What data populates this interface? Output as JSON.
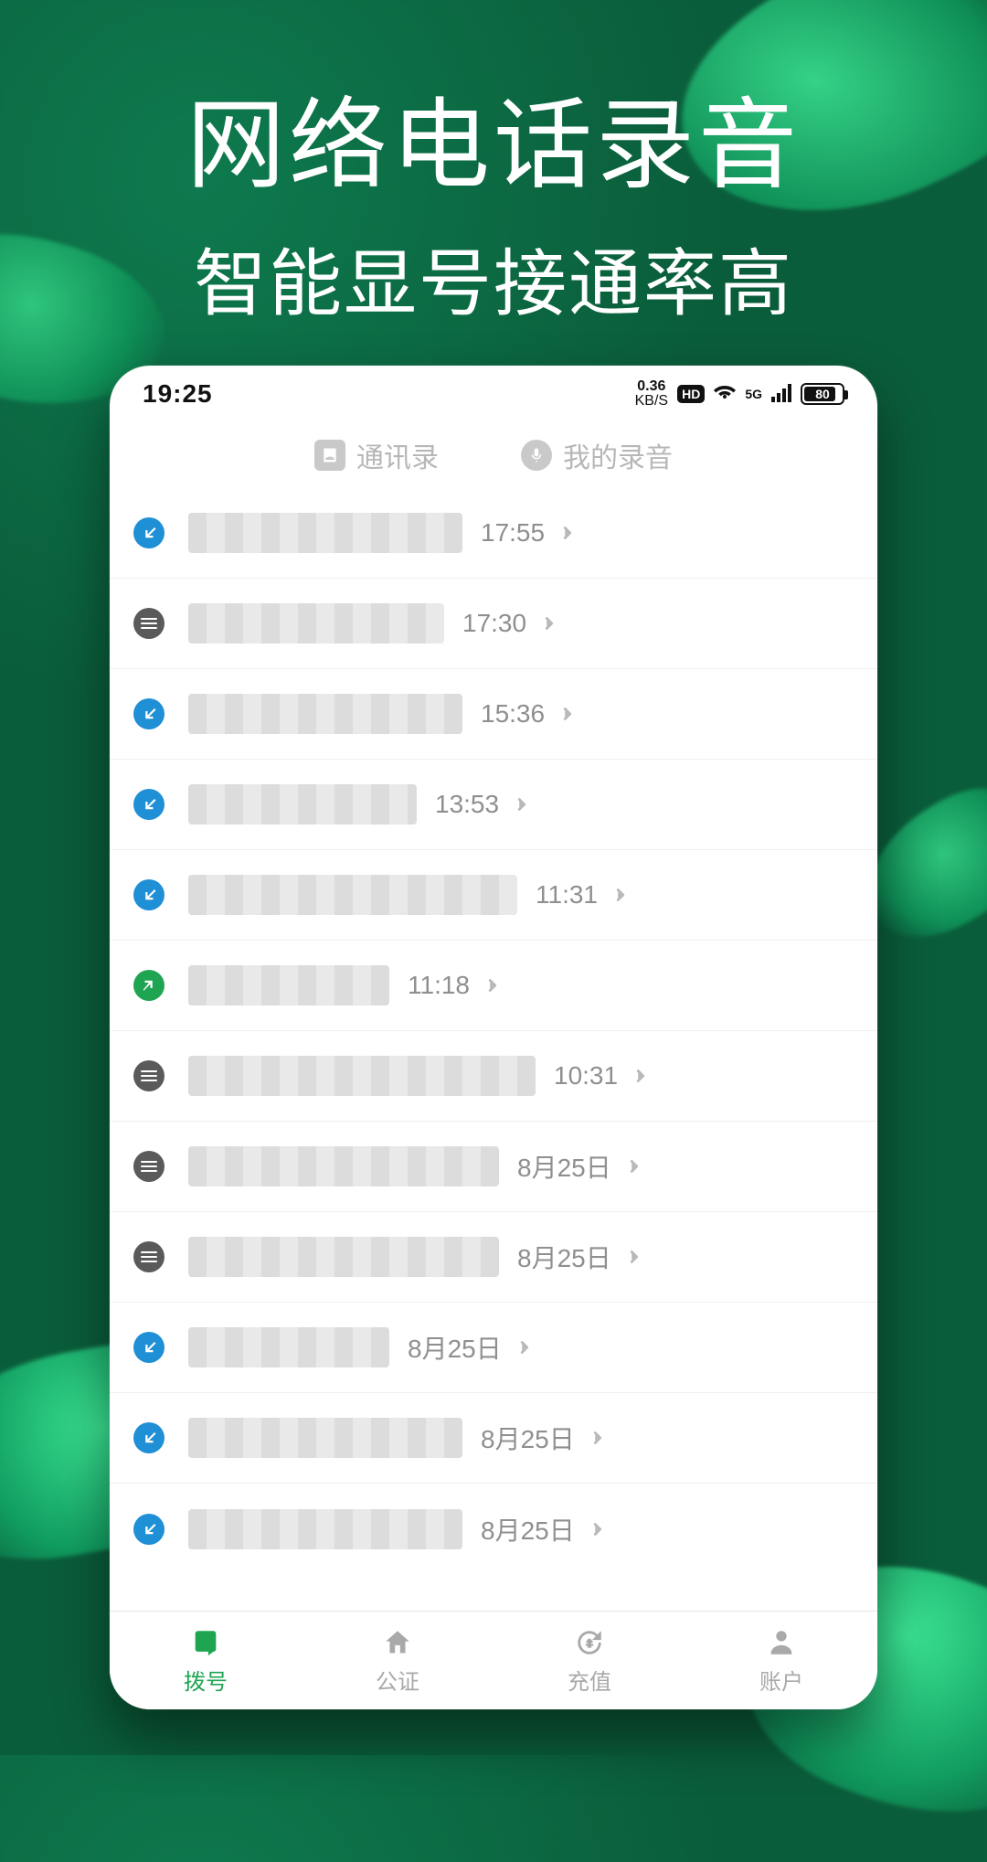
{
  "headline": {
    "title": "网络电话录音",
    "subtitle": "智能显号接通率高"
  },
  "statusbar": {
    "time": "19:25",
    "speed_value": "0.36",
    "speed_unit": "KB/S",
    "hd": "HD",
    "signal_label": "5G",
    "battery": "80"
  },
  "top_tabs": {
    "contacts": "通讯录",
    "recordings": "我的录音"
  },
  "calls": [
    {
      "type": "in",
      "time": "17:55",
      "blur_w": "w300"
    },
    {
      "type": "log",
      "time": "17:30",
      "blur_w": "w280"
    },
    {
      "type": "in",
      "time": "15:36",
      "blur_w": "w300"
    },
    {
      "type": "in",
      "time": "13:53",
      "blur_w": "w250"
    },
    {
      "type": "in",
      "time": "11:31",
      "blur_w": "w360"
    },
    {
      "type": "out",
      "time": "11:18",
      "blur_w": "w220"
    },
    {
      "type": "log",
      "time": "10:31",
      "blur_w": "w380"
    },
    {
      "type": "log",
      "time": "8月25日",
      "blur_w": "w340"
    },
    {
      "type": "log",
      "time": "8月25日",
      "blur_w": "w340"
    },
    {
      "type": "in",
      "time": "8月25日",
      "blur_w": "w220"
    },
    {
      "type": "in",
      "time": "8月25日",
      "blur_w": "w300"
    },
    {
      "type": "in",
      "time": "8月25日",
      "blur_w": "w300"
    }
  ],
  "nav": {
    "dial": "拨号",
    "notary": "公证",
    "recharge": "充值",
    "account": "账户"
  }
}
